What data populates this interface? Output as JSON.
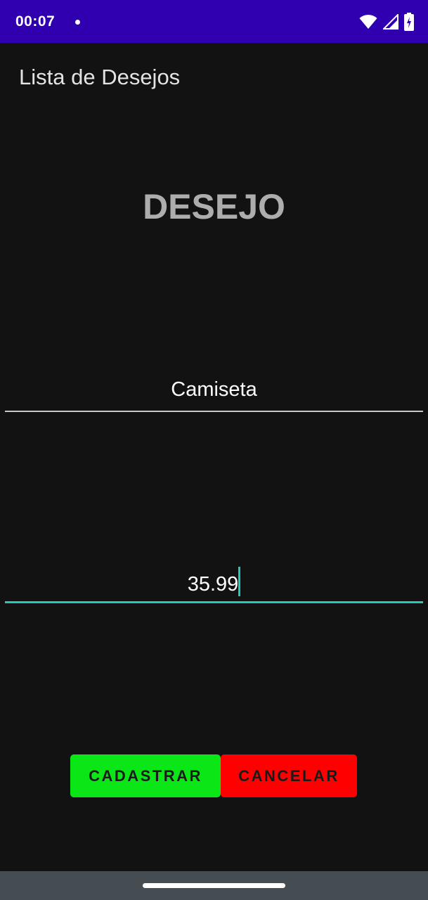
{
  "status_bar": {
    "time": "00:07",
    "icons": [
      "wifi-icon",
      "signal-icon",
      "battery-icon"
    ]
  },
  "app_bar": {
    "title": "Lista de Desejos"
  },
  "form": {
    "heading": "DESEJO",
    "name_field": {
      "value": "Camiseta"
    },
    "price_field": {
      "value": "35.99"
    }
  },
  "buttons": {
    "save_label": "CADASTRAR",
    "cancel_label": "CANCELAR"
  },
  "colors": {
    "status_bar": "#3000b0",
    "background": "#121212",
    "accent": "#26c6b8",
    "save_button": "#0be716",
    "cancel_button": "#ff0000",
    "nav_bar": "#454c52"
  }
}
